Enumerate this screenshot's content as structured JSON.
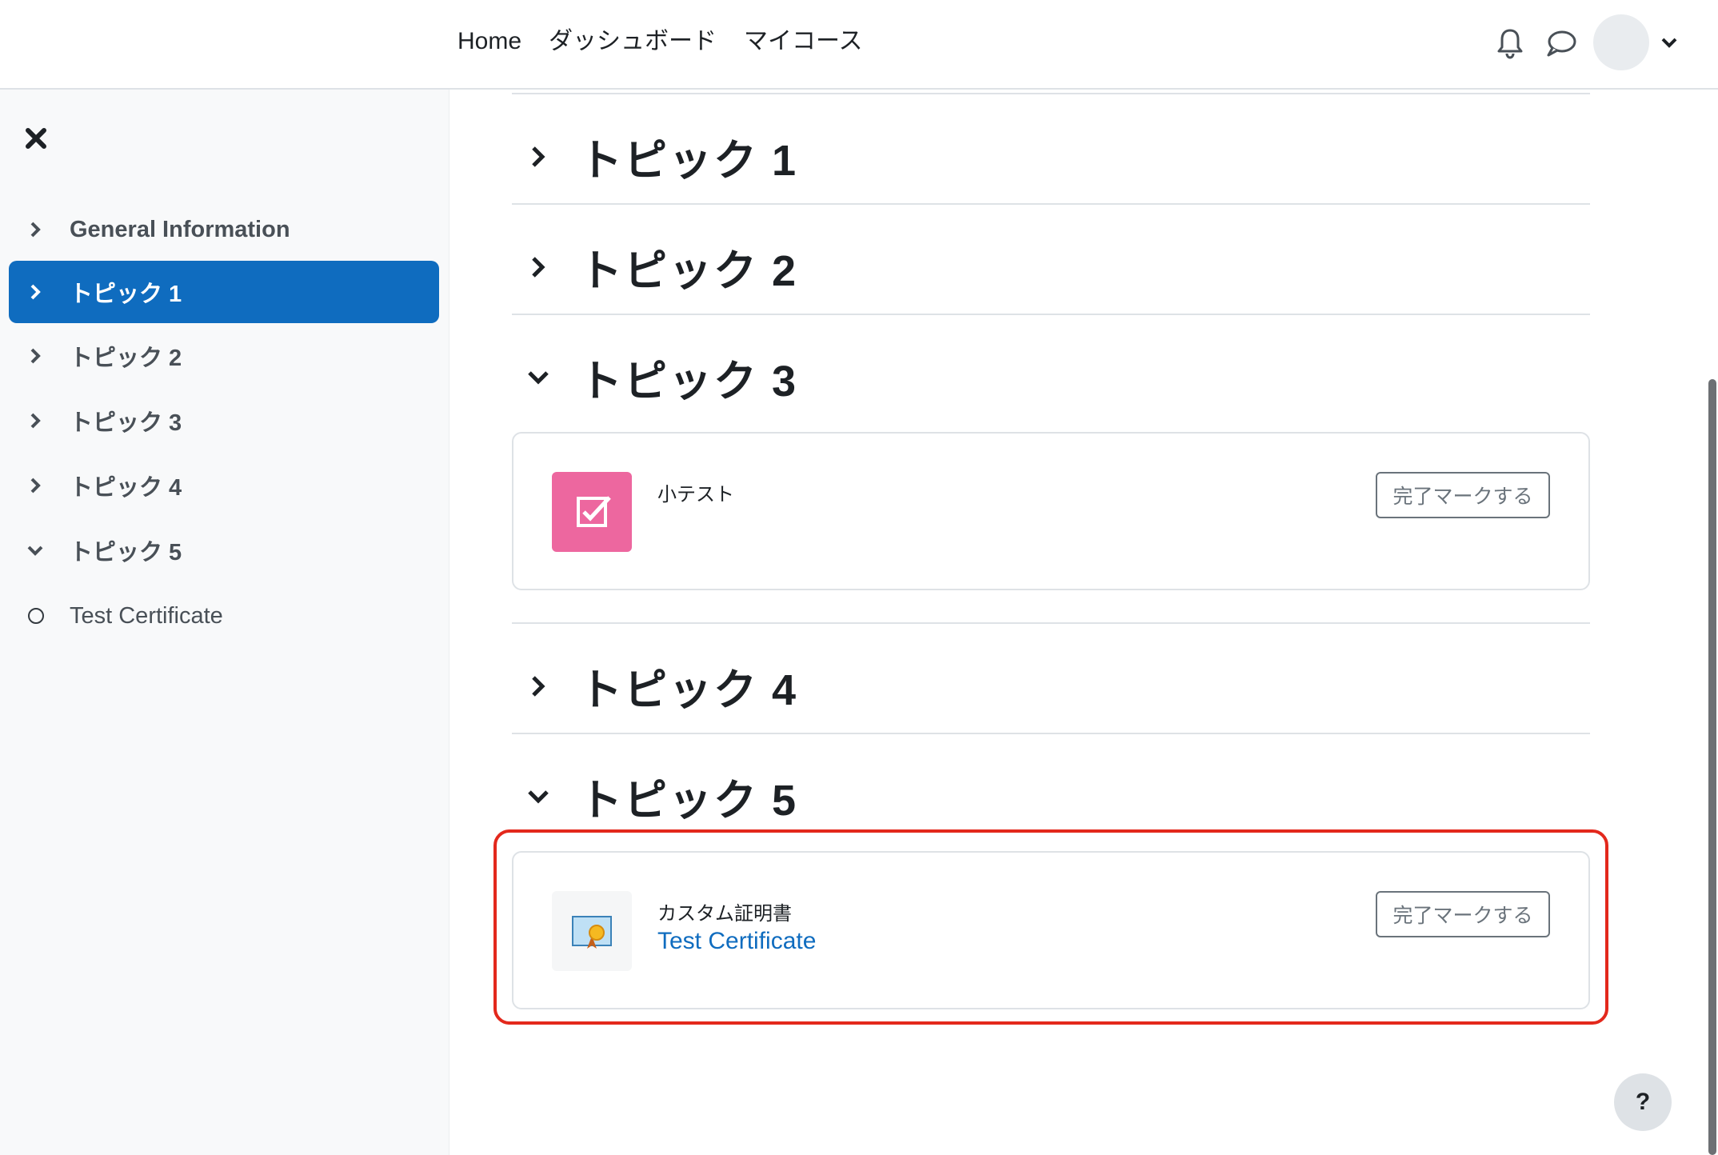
{
  "nav": {
    "items": [
      "Home",
      "ダッシュボード",
      "マイコース"
    ]
  },
  "icons": {
    "notifications": "bell-icon",
    "messages": "chat-bubble-icon",
    "user_menu": "chevron-down-icon",
    "close_drawer": "close-icon"
  },
  "sidebar": {
    "items": [
      {
        "label": "General Information",
        "state": "collapsed"
      },
      {
        "label": "トピック 1",
        "state": "collapsed",
        "active": true
      },
      {
        "label": "トピック 2",
        "state": "collapsed"
      },
      {
        "label": "トピック 3",
        "state": "collapsed"
      },
      {
        "label": "トピック 4",
        "state": "collapsed"
      },
      {
        "label": "トピック 5",
        "state": "expanded"
      },
      {
        "label": "Test Certificate",
        "state": "incomplete"
      }
    ]
  },
  "sections": [
    {
      "title": "トピック 1",
      "expanded": false
    },
    {
      "title": "トピック 2",
      "expanded": false
    },
    {
      "title": "トピック 3",
      "expanded": true
    },
    {
      "title": "トピック 4",
      "expanded": false
    },
    {
      "title": "トピック 5",
      "expanded": true
    }
  ],
  "activities": {
    "quiz": {
      "type": "小テスト",
      "name": "",
      "button": "完了マークする",
      "icon": "quiz-checkbox-icon"
    },
    "certificate": {
      "type": "カスタム証明書",
      "name": "Test Certificate",
      "button": "完了マークする",
      "icon": "certificate-icon"
    }
  },
  "help": {
    "label": "?"
  },
  "colors": {
    "accent": "#0f6cbf",
    "quiz_icon_bg": "#ed679f",
    "highlight_border": "#e3281c"
  }
}
